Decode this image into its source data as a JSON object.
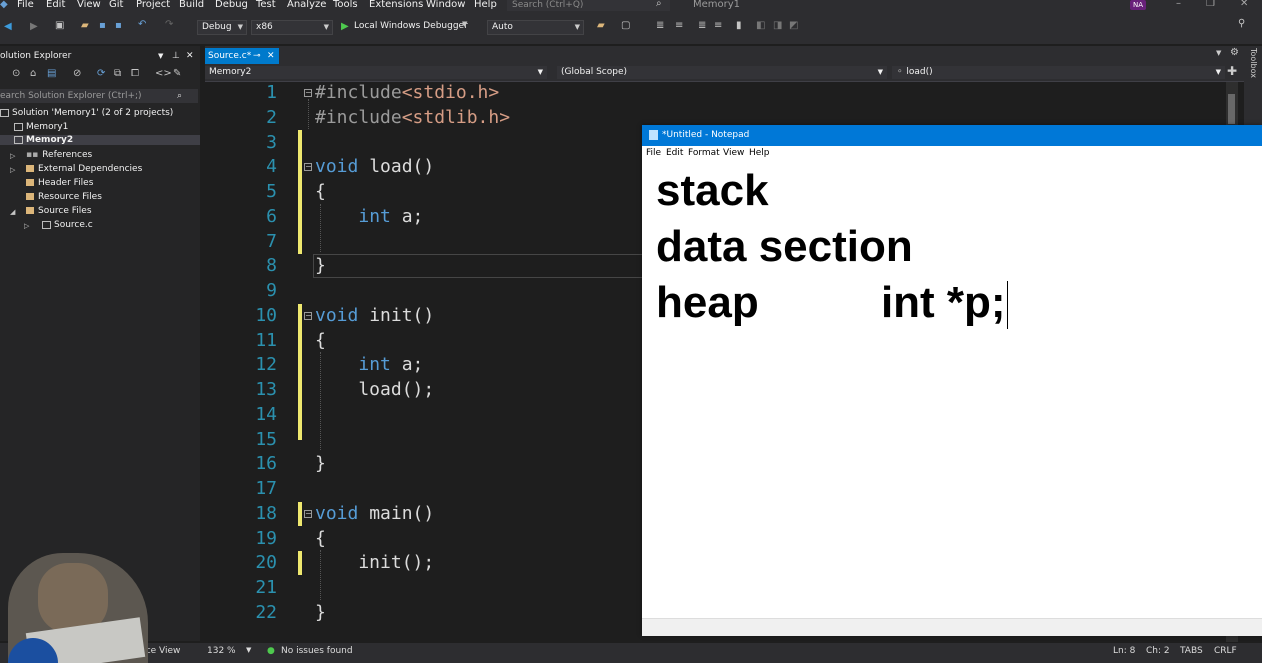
{
  "menu": {
    "items": [
      "File",
      "Edit",
      "View",
      "Git",
      "Project",
      "Build",
      "Debug",
      "Test",
      "Analyze",
      "Tools",
      "Extensions",
      "Window",
      "Help"
    ],
    "search_placeholder": "Search (Ctrl+Q)",
    "window_title": "Memory1",
    "user_initials": "NA"
  },
  "toolbar": {
    "config": "Debug",
    "platform": "x86",
    "run_label": "Local Windows Debugger",
    "solution_config": "Auto"
  },
  "solution_explorer": {
    "title": "olution Explorer",
    "search_placeholder": "earch Solution Explorer (Ctrl+;)",
    "items": [
      {
        "label": "Solution 'Memory1' (2 of 2 projects)"
      },
      {
        "label": "Memory1"
      },
      {
        "label": "Memory2"
      },
      {
        "label": "References"
      },
      {
        "label": "External Dependencies"
      },
      {
        "label": "Header Files"
      },
      {
        "label": "Resource Files"
      },
      {
        "label": "Source Files"
      },
      {
        "label": "Source.c"
      }
    ],
    "bottom_tab": "ource View"
  },
  "editor": {
    "tab_label": "Source.c*",
    "nav": {
      "project": "Memory2",
      "scope": "(Global Scope)",
      "member": "load()"
    },
    "lines": [
      {
        "n": "1",
        "code": "#include<stdio.h>"
      },
      {
        "n": "2",
        "code": "#include<stdlib.h>"
      },
      {
        "n": "3",
        "code": ""
      },
      {
        "n": "4",
        "code": "void load()"
      },
      {
        "n": "5",
        "code": "{"
      },
      {
        "n": "6",
        "code": "    int a;"
      },
      {
        "n": "7",
        "code": ""
      },
      {
        "n": "8",
        "code": "}"
      },
      {
        "n": "9",
        "code": ""
      },
      {
        "n": "10",
        "code": "void init()"
      },
      {
        "n": "11",
        "code": "{"
      },
      {
        "n": "12",
        "code": "    int a;"
      },
      {
        "n": "13",
        "code": "    load();"
      },
      {
        "n": "14",
        "code": ""
      },
      {
        "n": "15",
        "code": ""
      },
      {
        "n": "16",
        "code": "}"
      },
      {
        "n": "17",
        "code": ""
      },
      {
        "n": "18",
        "code": "void main()"
      },
      {
        "n": "19",
        "code": "{"
      },
      {
        "n": "20",
        "code": "    init();"
      },
      {
        "n": "21",
        "code": ""
      },
      {
        "n": "22",
        "code": "}"
      }
    ]
  },
  "notepad": {
    "title": "*Untitled - Notepad",
    "menu": [
      "File",
      "Edit",
      "Format",
      "View",
      "Help"
    ],
    "lines": [
      "stack",
      "data section",
      "heap          int *p;"
    ]
  },
  "status": {
    "zoom": "132 %",
    "issues": "No issues found",
    "ln": "Ln: 8",
    "ch": "Ch: 2",
    "tabs": "TABS",
    "eol": "CRLF"
  },
  "side_panel": {
    "toolbox": "Toolbox"
  }
}
